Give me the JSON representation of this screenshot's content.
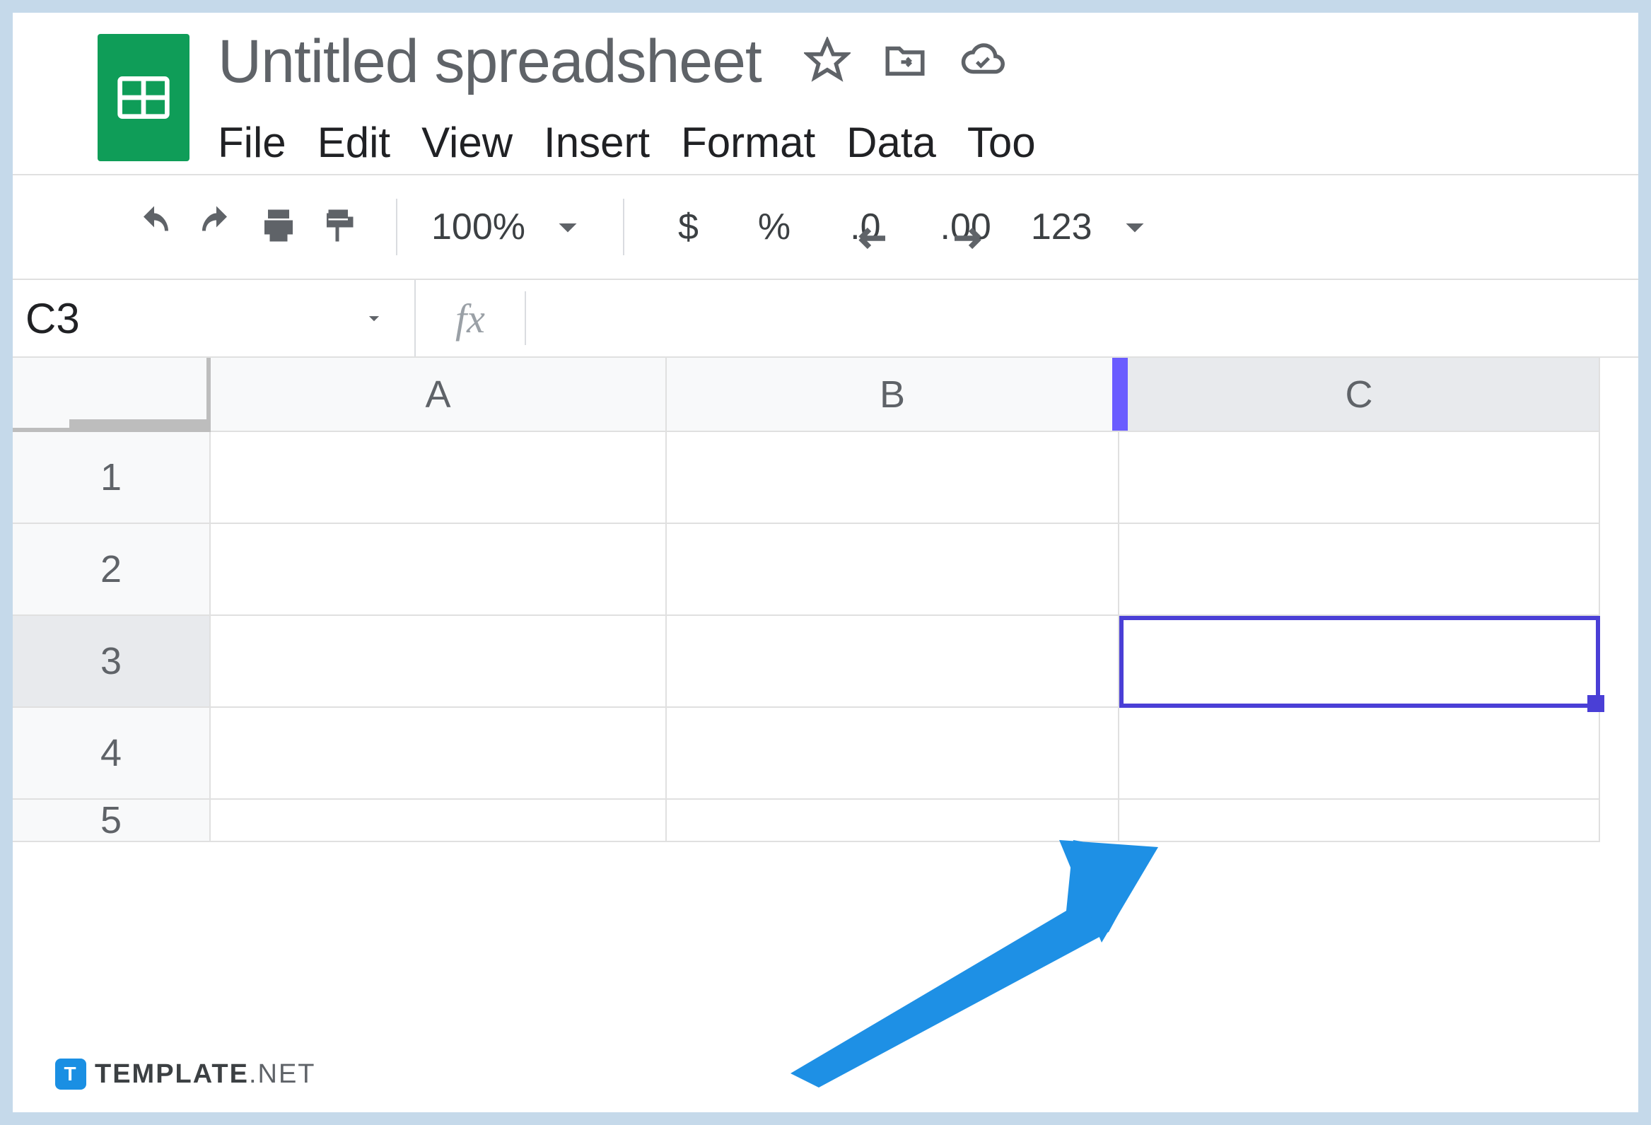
{
  "header": {
    "title": "Untitled spreadsheet"
  },
  "menubar": {
    "file": "File",
    "edit": "Edit",
    "view": "View",
    "insert": "Insert",
    "format": "Format",
    "data": "Data",
    "tools": "Too"
  },
  "toolbar": {
    "zoom": "100%",
    "currency": "$",
    "percent": "%",
    "dec_minus": ".0",
    "dec_plus": ".00",
    "num_format": "123"
  },
  "namebox": {
    "cell_ref": "C3",
    "fx": "fx"
  },
  "columns": [
    "A",
    "B",
    "C"
  ],
  "rows": [
    "1",
    "2",
    "3",
    "4",
    "5"
  ],
  "selected": {
    "col": "C",
    "row": "3"
  },
  "watermark": {
    "brand": "TEMPLATE",
    "suffix": ".NET",
    "logo_letter": "T"
  }
}
